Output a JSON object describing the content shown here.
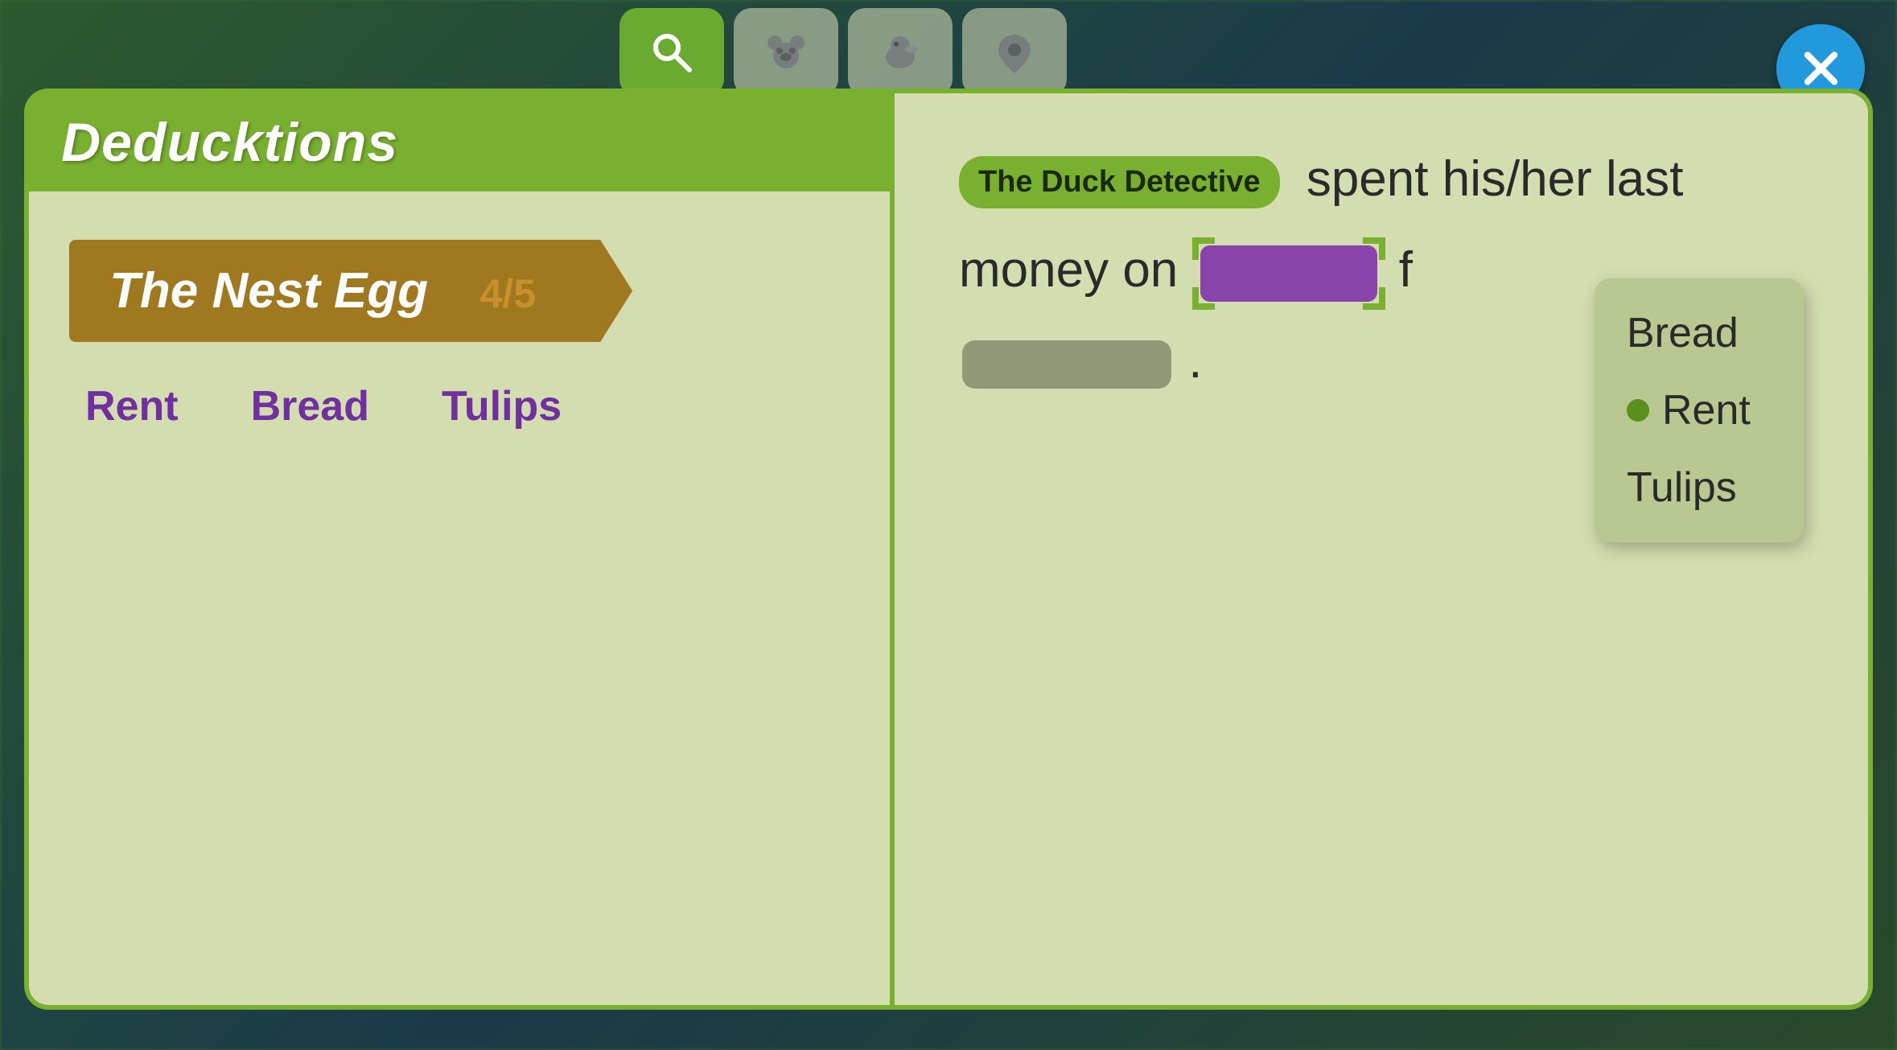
{
  "app": {
    "title": "The Duck Detective - Deducktions"
  },
  "nav": {
    "tabs": [
      {
        "id": "search",
        "icon": "search",
        "active": true
      },
      {
        "id": "bear",
        "icon": "bear",
        "active": false
      },
      {
        "id": "duck",
        "icon": "duck",
        "active": false
      },
      {
        "id": "location",
        "icon": "location",
        "active": false
      }
    ]
  },
  "left_page": {
    "title": "Deducktions",
    "chapter": {
      "name": "The Nest Egg",
      "progress": "4/5"
    },
    "answer_options": [
      "Rent",
      "Bread",
      "Tulips"
    ]
  },
  "right_page": {
    "subject_badge": "The Duck Detective",
    "sentence_part1": "spent his/her last",
    "sentence_part2": "money on",
    "sentence_part3": "f",
    "sentence_end": ".",
    "dropdown": {
      "items": [
        {
          "label": "Bread",
          "selected": false
        },
        {
          "label": "Rent",
          "selected": true
        },
        {
          "label": "Tulips",
          "selected": false
        }
      ]
    }
  },
  "close_button": {
    "label": "×"
  }
}
